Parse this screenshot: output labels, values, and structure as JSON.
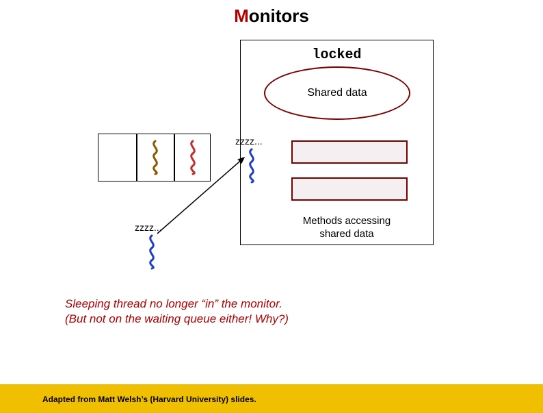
{
  "title_prefix": "M",
  "title_rest": "onitors",
  "monitor": {
    "locked": "locked",
    "shared_data": "Shared data",
    "methods_caption_l1": "Methods accessing",
    "methods_caption_l2": "shared data"
  },
  "zzzz1": "zzzz...",
  "zzzz2": "zzzz...",
  "explain_l1": "Sleeping thread no longer “in” the monitor.",
  "explain_l2": "(But not on the waiting queue either! Why?)",
  "footer": "Adapted from Matt Welsh’s (Harvard University) slides.",
  "colors": {
    "accent": "#b00000",
    "dark_red": "#7a0000",
    "footer_bg": "#f0c000"
  }
}
